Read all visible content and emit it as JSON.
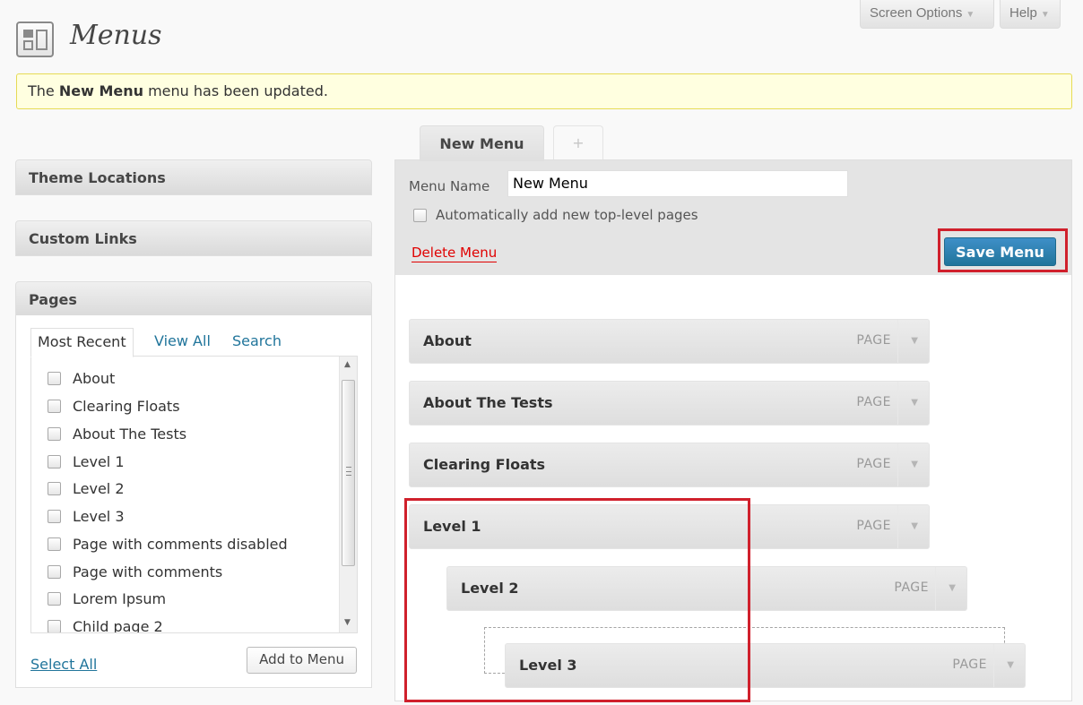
{
  "header": {
    "title": "Menus",
    "screen_options_label": "Screen Options",
    "help_label": "Help",
    "dropdown_glyph": "▼"
  },
  "notice": {
    "prefix": "The ",
    "menu_name": "New Menu",
    "suffix": " menu has been updated."
  },
  "sidebar": {
    "theme_locations": "Theme Locations",
    "custom_links": "Custom Links",
    "pages": {
      "title": "Pages",
      "tabs": [
        "Most Recent",
        "View All",
        "Search"
      ],
      "items": [
        "About",
        "Clearing Floats",
        "About The Tests",
        "Level 1",
        "Level 2",
        "Level 3",
        "Page with comments disabled",
        "Page with comments",
        "Lorem Ipsum",
        "Child page 2"
      ],
      "select_all": "Select All",
      "add_to_menu": "Add to Menu"
    }
  },
  "menu_tabs": {
    "active": "New Menu",
    "add": "+"
  },
  "menu_editor": {
    "name_label": "Menu Name",
    "name_value": "New Menu",
    "auto_add_label": "Automatically add new top-level pages",
    "delete_label": "Delete Menu",
    "save_label": "Save Menu"
  },
  "menu_items": [
    {
      "title": "About",
      "type": "PAGE",
      "depth": 0
    },
    {
      "title": "About The Tests",
      "type": "PAGE",
      "depth": 0
    },
    {
      "title": "Clearing Floats",
      "type": "PAGE",
      "depth": 0
    },
    {
      "title": "Level 1",
      "type": "PAGE",
      "depth": 0
    },
    {
      "title": "Level 2",
      "type": "PAGE",
      "depth": 1
    },
    {
      "title": "Level 3",
      "type": "PAGE",
      "depth": 2
    }
  ],
  "colors": {
    "link": "#21759b",
    "save_button": "#21759b",
    "delete_link": "#e00000",
    "highlight_box": "#d0202c",
    "notice_bg": "#ffffe0"
  }
}
